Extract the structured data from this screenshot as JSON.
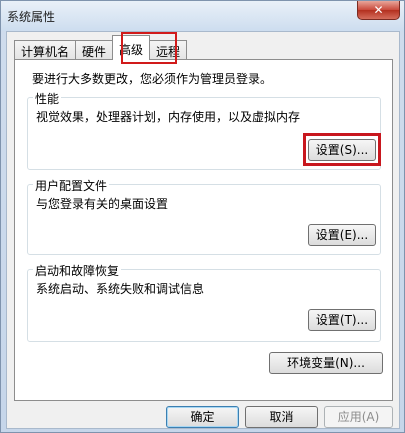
{
  "window": {
    "title": "系统属性",
    "close_glyph": "✕"
  },
  "tabs": [
    {
      "label": "计算机名",
      "active": false
    },
    {
      "label": "硬件",
      "active": false
    },
    {
      "label": "高级",
      "active": true
    },
    {
      "label": "远程",
      "active": false
    }
  ],
  "advanced": {
    "admin_note": "要进行大多数更改，您必须作为管理员登录。",
    "performance": {
      "label": "性能",
      "description": "视觉效果，处理器计划，内存使用，以及虚拟内存",
      "button": "设置(S)..."
    },
    "user_profiles": {
      "label": "用户配置文件",
      "description": "与您登录有关的桌面设置",
      "button": "设置(E)..."
    },
    "startup_recovery": {
      "label": "启动和故障恢复",
      "description": "系统启动、系统失败和调试信息",
      "button": "设置(T)..."
    },
    "env_button": "环境变量(N)..."
  },
  "footer": {
    "ok": "确定",
    "cancel": "取消",
    "apply": "应用(A)"
  },
  "colors": {
    "highlight": "#d11a1a"
  }
}
